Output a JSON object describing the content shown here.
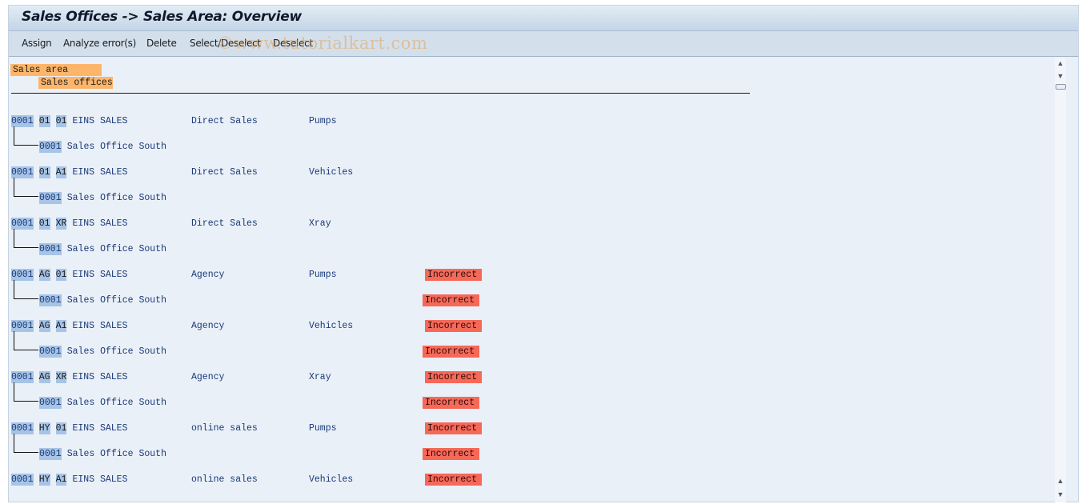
{
  "window": {
    "title": "Sales Offices -> Sales Area: Overview"
  },
  "toolbar": {
    "buttons": [
      "Assign",
      "Analyze error(s)",
      "Delete",
      "Select/Deselect",
      "Deselect"
    ],
    "watermark": "©www.tutorialkart.com"
  },
  "legend": {
    "level1": "Sales area",
    "level2": "Sales offices"
  },
  "status_colors": {
    "incorrect": "#f66858",
    "key_highlight": "#a6c4e6",
    "header_highlight": "#fdb56a"
  },
  "entries": [
    {
      "sales_org": "0001",
      "dist_channel": "01",
      "division": "01",
      "org_name": "EINS SALES",
      "channel_name": "Direct Sales",
      "division_name": "Pumps",
      "status": "",
      "office": {
        "code": "0001",
        "name": "Sales Office South",
        "status": ""
      }
    },
    {
      "sales_org": "0001",
      "dist_channel": "01",
      "division": "A1",
      "org_name": "EINS SALES",
      "channel_name": "Direct Sales",
      "division_name": "Vehicles",
      "status": "",
      "office": {
        "code": "0001",
        "name": "Sales Office South",
        "status": ""
      }
    },
    {
      "sales_org": "0001",
      "dist_channel": "01",
      "division": "XR",
      "org_name": "EINS SALES",
      "channel_name": "Direct Sales",
      "division_name": "Xray",
      "status": "",
      "office": {
        "code": "0001",
        "name": "Sales Office South",
        "status": ""
      }
    },
    {
      "sales_org": "0001",
      "dist_channel": "AG",
      "division": "01",
      "org_name": "EINS SALES",
      "channel_name": "Agency",
      "division_name": "Pumps",
      "status": "Incorrect",
      "office": {
        "code": "0001",
        "name": "Sales Office South",
        "status": "Incorrect"
      }
    },
    {
      "sales_org": "0001",
      "dist_channel": "AG",
      "division": "A1",
      "org_name": "EINS SALES",
      "channel_name": "Agency",
      "division_name": "Vehicles",
      "status": "Incorrect",
      "office": {
        "code": "0001",
        "name": "Sales Office South",
        "status": "Incorrect"
      }
    },
    {
      "sales_org": "0001",
      "dist_channel": "AG",
      "division": "XR",
      "org_name": "EINS SALES",
      "channel_name": "Agency",
      "division_name": "Xray",
      "status": "Incorrect",
      "office": {
        "code": "0001",
        "name": "Sales Office South",
        "status": "Incorrect"
      }
    },
    {
      "sales_org": "0001",
      "dist_channel": "HY",
      "division": "01",
      "org_name": "EINS SALES",
      "channel_name": "online sales",
      "division_name": "Pumps",
      "status": "Incorrect",
      "office": {
        "code": "0001",
        "name": "Sales Office South",
        "status": "Incorrect"
      }
    },
    {
      "sales_org": "0001",
      "dist_channel": "HY",
      "division": "A1",
      "org_name": "EINS SALES",
      "channel_name": "online sales",
      "division_name": "Vehicles",
      "status": "Incorrect",
      "office": null
    }
  ]
}
